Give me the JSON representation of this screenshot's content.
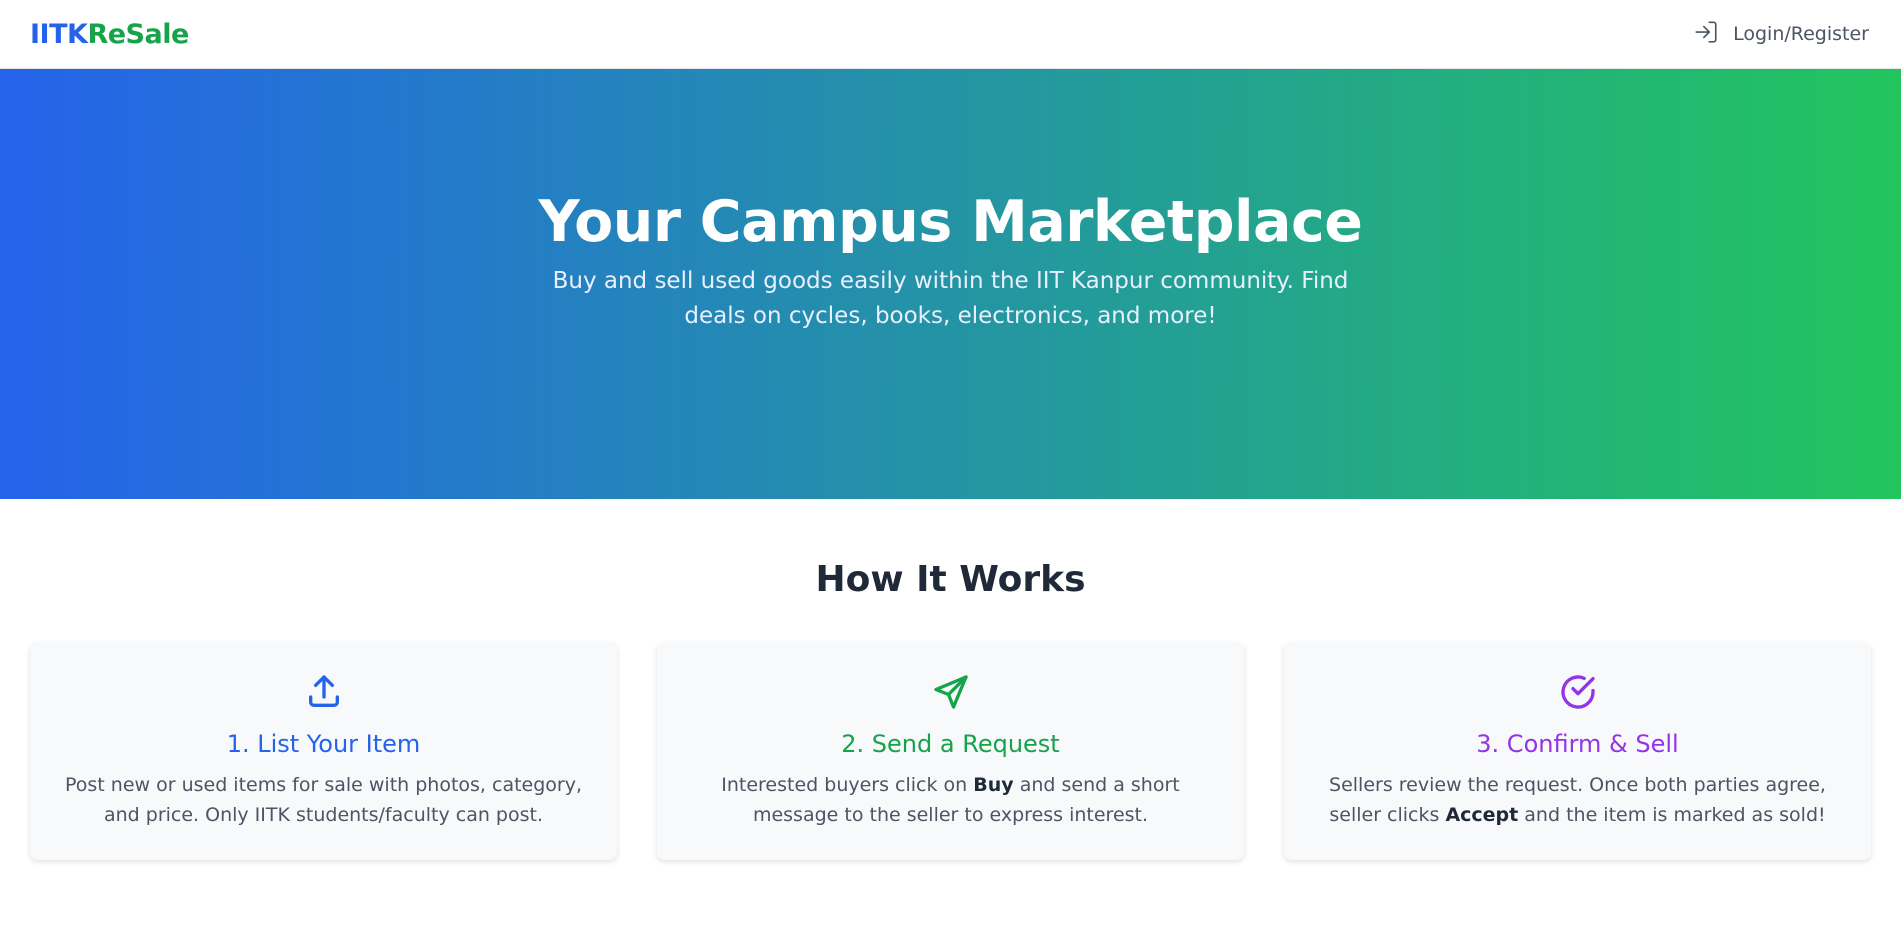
{
  "header": {
    "logo_part1": "IITK",
    "logo_part2": "ReSale",
    "login_label": "Login/Register",
    "login_icon": "login-icon"
  },
  "hero": {
    "title": "Your Campus Marketplace",
    "subtitle": "Buy and sell used goods easily within the IIT Kanpur community. Find deals on cycles, books, electronics, and more!"
  },
  "how_it_works": {
    "title": "How It Works",
    "steps": [
      {
        "icon": "upload-icon",
        "title": "1. List Your Item",
        "desc": "Post new or used items for sale with photos, category, and price. Only IITK students/faculty can post.",
        "color": "#2563eb"
      },
      {
        "icon": "send-icon",
        "title": "2. Send a Request",
        "desc_before": "Interested buyers click on ",
        "desc_bold": "Buy",
        "desc_after": " and send a short message to the seller to express interest.",
        "color": "#16a34a"
      },
      {
        "icon": "check-circle-icon",
        "title": "3. Confirm & Sell",
        "desc_before": "Sellers review the request. Once both parties agree, seller clicks ",
        "desc_bold": "Accept",
        "desc_after": " and the item is marked as sold!",
        "color": "#9333ea"
      }
    ]
  },
  "colors": {
    "brand_blue": "#2563eb",
    "brand_green": "#16a34a",
    "accent_purple": "#9333ea"
  }
}
